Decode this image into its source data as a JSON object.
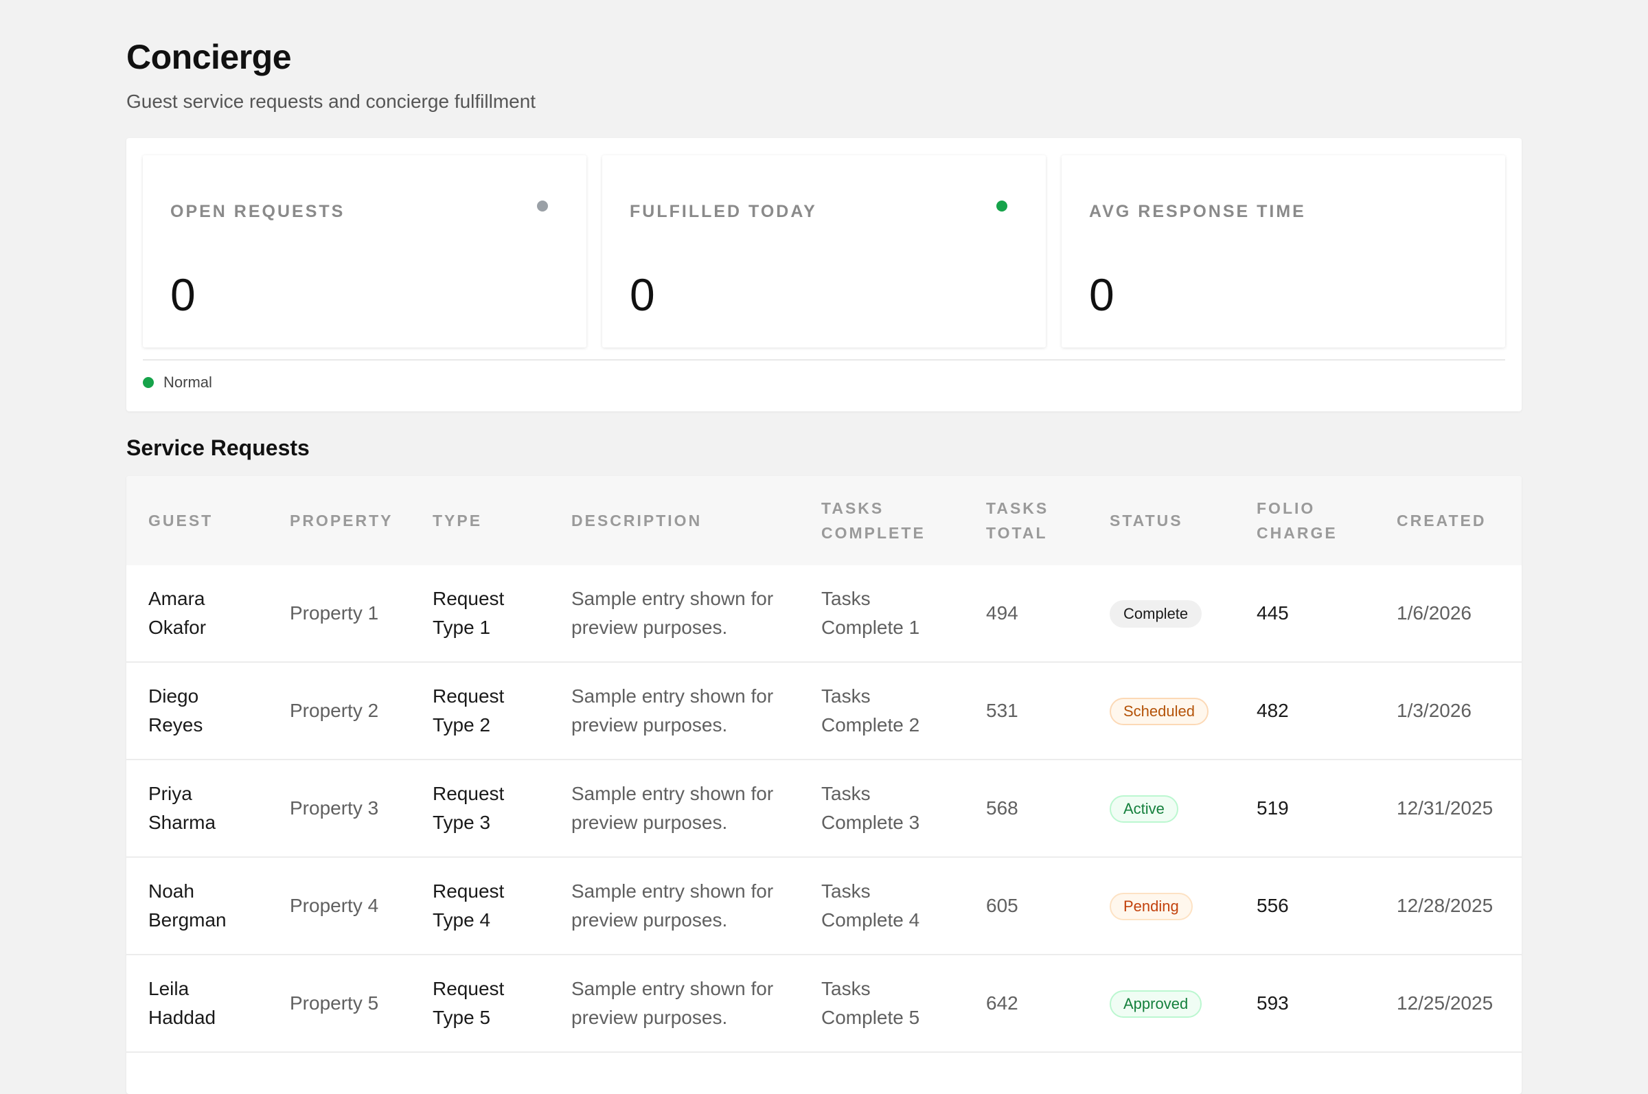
{
  "header": {
    "title": "Concierge",
    "subtitle": "Guest service requests and concierge fulfillment"
  },
  "stats": [
    {
      "label": "OPEN REQUESTS",
      "value": "0",
      "dot_color": "#9aa0a6"
    },
    {
      "label": "FULFILLED TODAY",
      "value": "0",
      "dot_color": "#16a34a"
    },
    {
      "label": "AVG RESPONSE TIME",
      "value": "0",
      "dot_color": null
    }
  ],
  "system_status": {
    "text": "Normal",
    "color": "#16a34a"
  },
  "section": {
    "title": "Service Requests"
  },
  "table": {
    "columns": [
      "GUEST",
      "PROPERTY",
      "TYPE",
      "DESCRIPTION",
      "TASKS COMPLETE",
      "TASKS TOTAL",
      "STATUS",
      "FOLIO CHARGE",
      "CREATED"
    ],
    "rows": [
      {
        "guest": "Amara Okafor",
        "property": "Property 1",
        "type": "Request Type 1",
        "description": "Sample entry shown for preview purposes.",
        "tasks_complete": "Tasks Complete 1",
        "tasks_total": "494",
        "status": "Complete",
        "folio_charge": "445",
        "created": "1/6/2026"
      },
      {
        "guest": "Diego Reyes",
        "property": "Property 2",
        "type": "Request Type 2",
        "description": "Sample entry shown for preview purposes.",
        "tasks_complete": "Tasks Complete 2",
        "tasks_total": "531",
        "status": "Scheduled",
        "folio_charge": "482",
        "created": "1/3/2026"
      },
      {
        "guest": "Priya Sharma",
        "property": "Property 3",
        "type": "Request Type 3",
        "description": "Sample entry shown for preview purposes.",
        "tasks_complete": "Tasks Complete 3",
        "tasks_total": "568",
        "status": "Active",
        "folio_charge": "519",
        "created": "12/31/2025"
      },
      {
        "guest": "Noah Bergman",
        "property": "Property 4",
        "type": "Request Type 4",
        "description": "Sample entry shown for preview purposes.",
        "tasks_complete": "Tasks Complete 4",
        "tasks_total": "605",
        "status": "Pending",
        "folio_charge": "556",
        "created": "12/28/2025"
      },
      {
        "guest": "Leila Haddad",
        "property": "Property 5",
        "type": "Request Type 5",
        "description": "Sample entry shown for preview purposes.",
        "tasks_complete": "Tasks Complete 5",
        "tasks_total": "642",
        "status": "Approved",
        "folio_charge": "593",
        "created": "12/25/2025"
      }
    ]
  },
  "status_colors": {
    "Complete": {
      "text": "#1a1a1a",
      "bg": "#f0f0f0",
      "border": "#f0f0f0"
    },
    "Scheduled": {
      "text": "#b45309",
      "bg": "#fff7ed",
      "border": "#fcd9b6"
    },
    "Active": {
      "text": "#15803d",
      "bg": "#f0fdf4",
      "border": "#bbf7d0"
    },
    "Pending": {
      "text": "#c2410c",
      "bg": "#fff7ed",
      "border": "#fde2c4"
    },
    "Approved": {
      "text": "#15803d",
      "bg": "#f0fdf4",
      "border": "#bbf7d0"
    }
  }
}
